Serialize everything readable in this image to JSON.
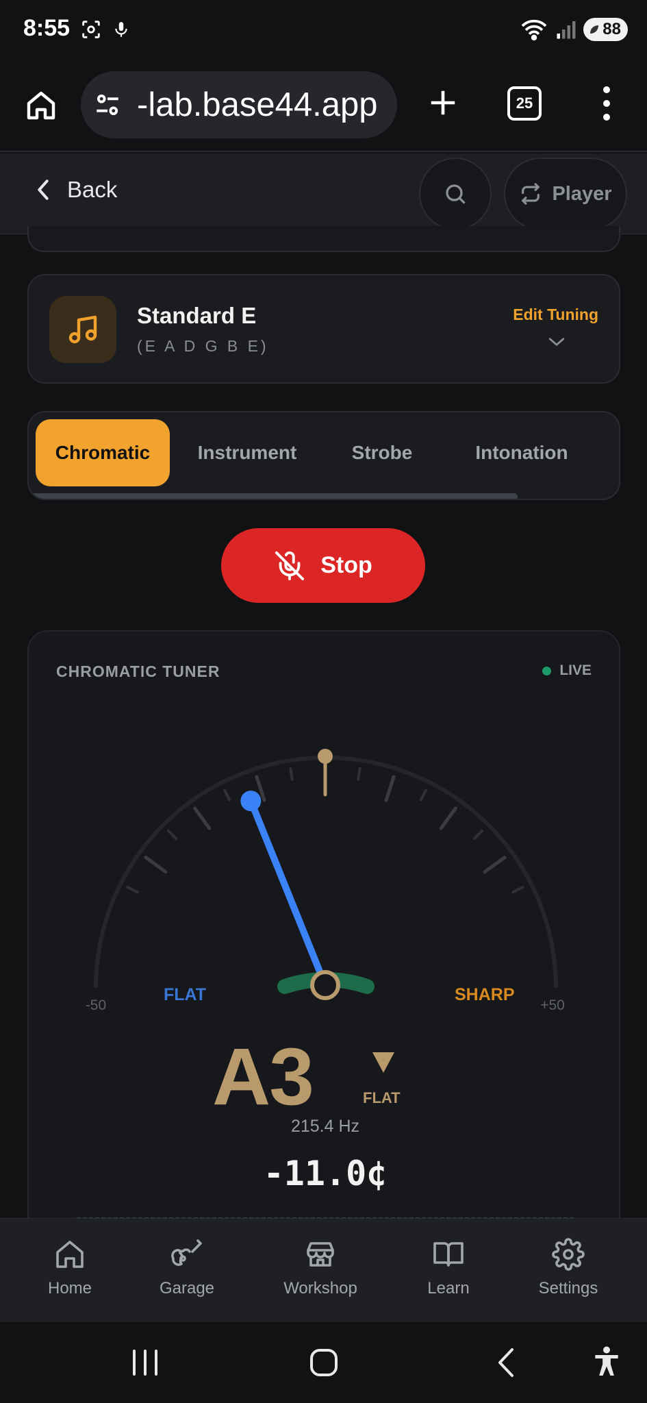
{
  "status_bar": {
    "time": "8:55",
    "battery": "88"
  },
  "browser": {
    "url": "-lab.base44.app",
    "tab_count": "25"
  },
  "header": {
    "back_label": "Back",
    "player_label": "Player"
  },
  "tuning": {
    "name": "Standard E",
    "notes": "(E A D G B E)",
    "edit_label": "Edit Tuning"
  },
  "modes": {
    "active": "Chromatic",
    "tabs": [
      {
        "label": "Chromatic"
      },
      {
        "label": "Instrument"
      },
      {
        "label": "Strobe"
      },
      {
        "label": "Intonation"
      }
    ]
  },
  "stop_button": {
    "label": "Stop"
  },
  "tuner": {
    "title": "CHROMATIC TUNER",
    "live_label": "LIVE",
    "flat_label": "FLAT",
    "sharp_label": "SHARP",
    "min_label": "-50",
    "max_label": "+50",
    "cents_value": -11.0,
    "note": "A3",
    "direction": "FLAT",
    "frequency": "215.4 Hz",
    "cents_display": "-11.0¢",
    "colors": {
      "needle": "#3b82f6",
      "target": "#b89a6c",
      "in_tune": "#1e6b4c",
      "flat": "#3a76d4",
      "sharp": "#d8891f"
    }
  },
  "bottom_nav": {
    "items": [
      {
        "label": "Home",
        "icon": "home-icon"
      },
      {
        "label": "Garage",
        "icon": "guitar-icon"
      },
      {
        "label": "Workshop",
        "icon": "store-icon"
      },
      {
        "label": "Learn",
        "icon": "book-icon"
      },
      {
        "label": "Settings",
        "icon": "gear-icon"
      }
    ]
  }
}
